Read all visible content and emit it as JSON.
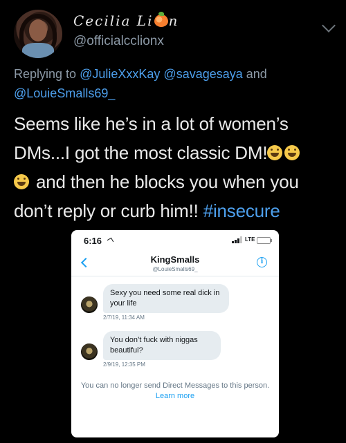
{
  "tweet": {
    "display_name_prefix": "Cecilia Li",
    "display_name_suffix": "n",
    "handle": "@officialcclionx",
    "reply_prefix": "Replying to",
    "reply_to": [
      "@JulieXxxKay",
      "@savagesaya",
      "@LouieSmalls69_"
    ],
    "reply_conjunction": "and",
    "text_part1": "Seems like he’s in a lot of women’s DMs...I got the most classic DM!",
    "text_part2": "and then he blocks you when you don’t reply or curb him!!",
    "hashtag": "#insecure",
    "emoji_name": "laughing-crying-cat-emoji",
    "link_color": "#4d9fec"
  },
  "screenshot": {
    "status_time": "6:16",
    "network": "LTE",
    "chat_name": "KingSmalls",
    "chat_handle": "@LouieSmalls69_",
    "info_glyph": "i",
    "messages": [
      {
        "text": "Sexy you need some real dick in your life",
        "timestamp": "2/7/19, 11:34 AM"
      },
      {
        "text": "You don’t fuck with niggas beautiful?",
        "timestamp": "2/9/19, 12:35 PM"
      }
    ],
    "blocked_note": "You can no longer send Direct Messages to this person.",
    "learn_more": "Learn more",
    "accent_color": "#1da1f2"
  }
}
